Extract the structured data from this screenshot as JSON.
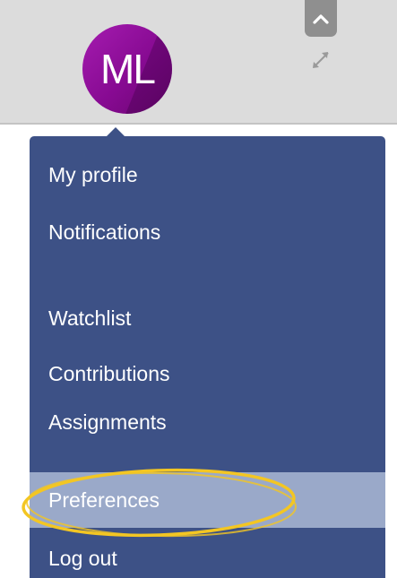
{
  "header": {
    "avatar_initials": "ML",
    "avatar_color": "#8e0f99",
    "collapse_icon": "chevron-up-icon",
    "expand_icon": "expand-arrows-icon"
  },
  "menu": {
    "background": "#3d5186",
    "highlight_color": "#9aa9c9",
    "items": [
      {
        "label": "My profile"
      },
      {
        "label": "Notifications"
      },
      {
        "label": "Watchlist"
      },
      {
        "label": "Contributions"
      },
      {
        "label": "Assignments"
      },
      {
        "label": "Preferences",
        "selected": true
      },
      {
        "label": "Log out"
      }
    ]
  },
  "annotation": {
    "shape": "ellipse",
    "color": "#f3c623",
    "target": "Preferences"
  }
}
